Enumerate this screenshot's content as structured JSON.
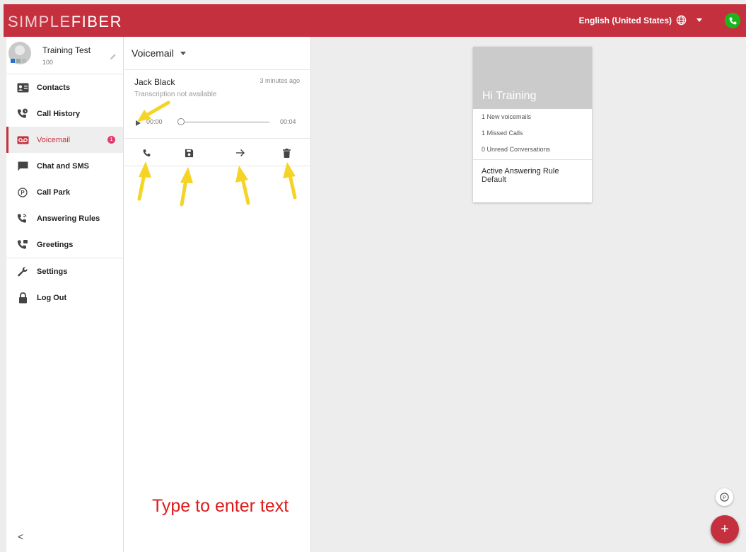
{
  "header": {
    "logo_part1": "SIMPLE",
    "logo_part2": "FIBER",
    "language": "English (United States)",
    "brand_color": "#c5303f"
  },
  "user": {
    "name": "Training Test",
    "extension": "100"
  },
  "sidebar": {
    "items": [
      {
        "label": "Contacts",
        "icon": "contacts-icon"
      },
      {
        "label": "Call History",
        "icon": "call-history-icon"
      },
      {
        "label": "Voicemail",
        "icon": "voicemail-icon",
        "active": true,
        "badge": "1"
      },
      {
        "label": "Chat and SMS",
        "icon": "chat-icon"
      },
      {
        "label": "Call Park",
        "icon": "call-park-icon"
      },
      {
        "label": "Answering Rules",
        "icon": "answering-rules-icon"
      },
      {
        "label": "Greetings",
        "icon": "greetings-icon"
      },
      {
        "label": "Settings",
        "icon": "wrench-icon"
      },
      {
        "label": "Log Out",
        "icon": "lock-icon"
      }
    ],
    "collapse_glyph": "<"
  },
  "voicemail": {
    "title": "Voicemail",
    "message": {
      "caller": "Jack Black",
      "time": "3 minutes ago",
      "transcription": "Transcription not available",
      "current_time": "00:00",
      "duration": "00:04",
      "progress": 0
    },
    "actions": [
      "phone-icon",
      "save-icon",
      "forward-arrow-icon",
      "trash-icon"
    ]
  },
  "annotation_text": "Type to enter text",
  "greeting_card": {
    "title": "Hi Training",
    "stats": [
      "1 New voicemails",
      "1 Missed Calls",
      "0 Unread Conversations"
    ],
    "rule_title": "Active Answering Rule",
    "rule_value": "Default"
  },
  "fab": {
    "park_label": "P",
    "add_label": "+"
  }
}
